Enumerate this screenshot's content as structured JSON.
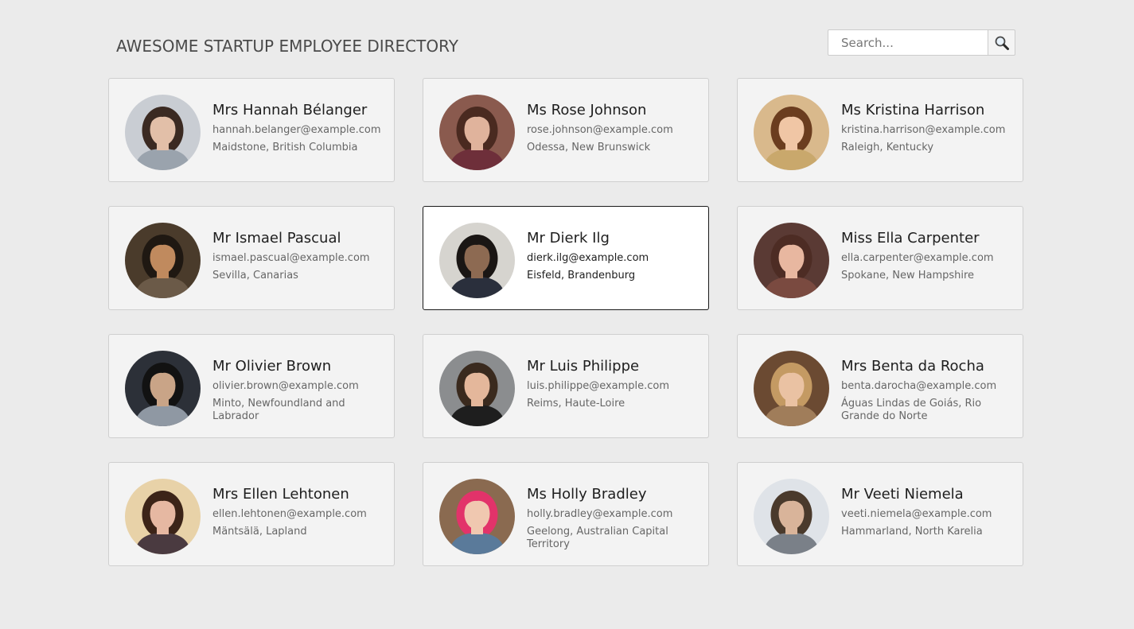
{
  "header": {
    "title": "AWESOME STARTUP EMPLOYEE DIRECTORY"
  },
  "search": {
    "placeholder": "Search...",
    "value": "",
    "button_icon": "search-icon"
  },
  "employees": [
    {
      "name": "Mrs Hannah Bélanger",
      "email": "hannah.belanger@example.com",
      "location": "Maidstone, British Columbia",
      "photo": {
        "bg": "#c9cdd3",
        "hair": "#3b2a22",
        "skin": "#e2bfa8",
        "shirt": "#9aa3ad"
      }
    },
    {
      "name": "Ms Rose Johnson",
      "email": "rose.johnson@example.com",
      "location": "Odessa, New Brunswick",
      "photo": {
        "bg": "#8a5a4e",
        "hair": "#4a2a20",
        "skin": "#e0b39c",
        "shirt": "#6e2f3a"
      }
    },
    {
      "name": "Ms Kristina Harrison",
      "email": "kristina.harrison@example.com",
      "location": "Raleigh, Kentucky",
      "photo": {
        "bg": "#d9b98c",
        "hair": "#6b3d1f",
        "skin": "#f0c6a5",
        "shirt": "#c9a86c"
      }
    },
    {
      "name": "Mr Ismael Pascual",
      "email": "ismael.pascual@example.com",
      "location": "Sevilla, Canarias",
      "photo": {
        "bg": "#4a3b2b",
        "hair": "#1f1812",
        "skin": "#c08a5e",
        "shirt": "#6b5a48"
      }
    },
    {
      "name": "Mr Dierk Ilg",
      "email": "dierk.ilg@example.com",
      "location": "Eisfeld, Brandenburg",
      "photo": {
        "bg": "#d6d4cf",
        "hair": "#1a1614",
        "skin": "#8d6a52",
        "shirt": "#2a2f3c"
      }
    },
    {
      "name": "Miss Ella Carpenter",
      "email": "ella.carpenter@example.com",
      "location": "Spokane, New Hampshire",
      "photo": {
        "bg": "#5a3a34",
        "hair": "#4d2c24",
        "skin": "#e8b7a0",
        "shirt": "#7a4a40"
      }
    },
    {
      "name": "Mr Olivier Brown",
      "email": "olivier.brown@example.com",
      "location": "Minto, Newfoundland and Labrador",
      "photo": {
        "bg": "#2c3038",
        "hair": "#121212",
        "skin": "#c9a487",
        "shirt": "#8f98a3"
      }
    },
    {
      "name": "Mr Luis Philippe",
      "email": "luis.philippe@example.com",
      "location": "Reims, Haute-Loire",
      "photo": {
        "bg": "#8b8d8f",
        "hair": "#3a2a1e",
        "skin": "#e4b79b",
        "shirt": "#1e1e1e"
      }
    },
    {
      "name": "Mrs Benta da Rocha",
      "email": "benta.darocha@example.com",
      "location": "Águas Lindas de Goiás, Rio Grande do Norte",
      "photo": {
        "bg": "#6b4a32",
        "hair": "#c49a63",
        "skin": "#eac2a3",
        "shirt": "#a07d5a"
      }
    },
    {
      "name": "Mrs Ellen Lehtonen",
      "email": "ellen.lehtonen@example.com",
      "location": "Mäntsälä, Lapland",
      "photo": {
        "bg": "#e8d2a8",
        "hair": "#3c2418",
        "skin": "#e6b8a2",
        "shirt": "#4a3a40"
      }
    },
    {
      "name": "Ms Holly Bradley",
      "email": "holly.bradley@example.com",
      "location": "Geelong, Australian Capital Territory",
      "photo": {
        "bg": "#8a6a50",
        "hair": "#e2336a",
        "skin": "#f0c8b0",
        "shirt": "#5a7a9a"
      }
    },
    {
      "name": "Mr Veeti Niemela",
      "email": "veeti.niemela@example.com",
      "location": "Hammarland, North Karelia",
      "photo": {
        "bg": "#dfe3e8",
        "hair": "#4a3a2c",
        "skin": "#d9b49a",
        "shirt": "#7a8088"
      }
    }
  ],
  "selected_index": 4
}
